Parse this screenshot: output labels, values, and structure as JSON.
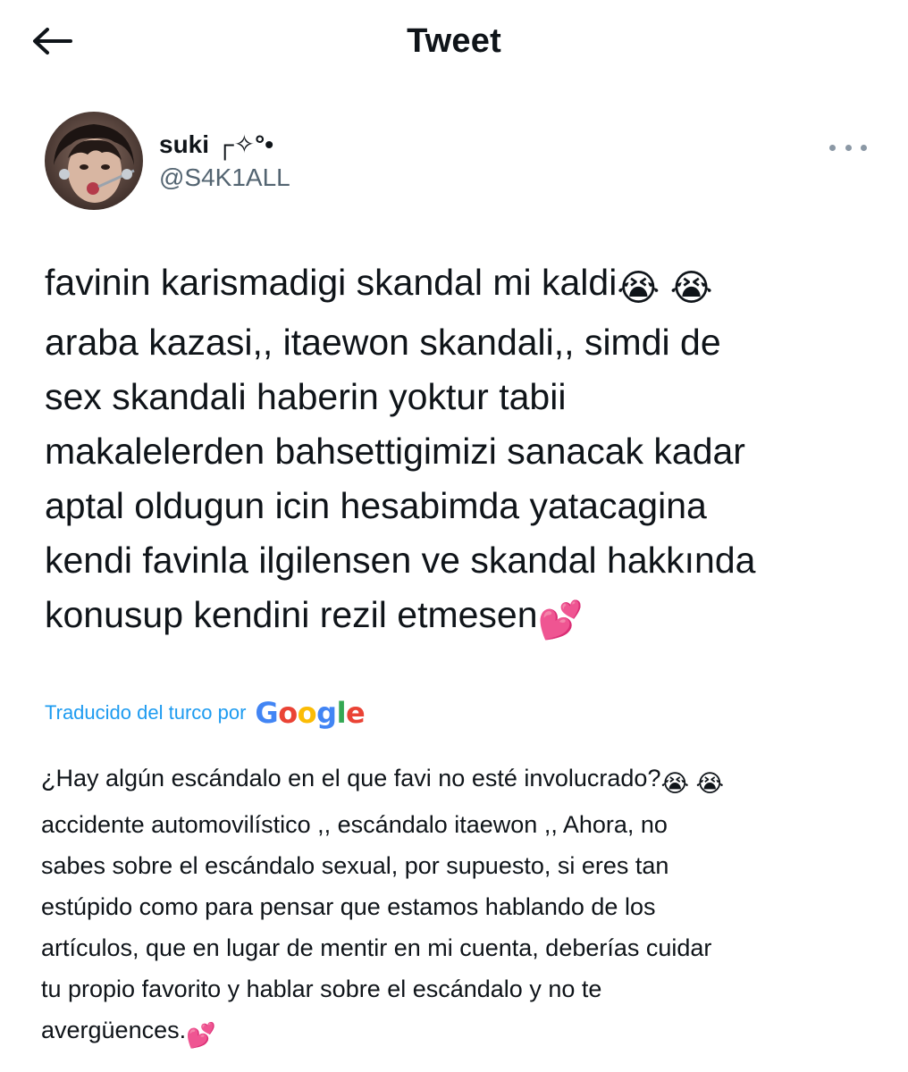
{
  "header": {
    "title": "Tweet",
    "back_icon": "arrow-left-icon"
  },
  "author": {
    "display_name": "suki ┌✧°•",
    "handle": "@S4K1ALL",
    "avatar_icon": "user-avatar",
    "more_icon": "more-horizontal-icon"
  },
  "tweet": {
    "line1": "favinin karismadigi skandal mi kaldi",
    "rest": "araba kazasi,, itaewon skandali,, simdi de\nsex skandali haberin yoktur tabii\nmakalelerden bahsettigimizi sanacak kadar\naptal oldugun icin hesabimda yatacagina\nkendi favinla ilgilensen ve skandal hakkında\nkonusup kendini rezil etmesen",
    "emoji_crying": "😭",
    "emoji_hearts": "💕"
  },
  "translation": {
    "label": "Traducido del turco por",
    "provider": "Google",
    "line1": "¿Hay algún escándalo en el que favi no esté involucrado?",
    "rest": "accidente automovilístico ,, escándalo itaewon ,, Ahora, no\nsabes sobre el escándalo sexual, por supuesto, si eres tan\nestúpido como para pensar que estamos hablando de los\nartículos, que en lugar de mentir en mi cuenta, deberías cuidar\ntu propio favorito y hablar sobre el escándalo y no te\navergüences."
  },
  "colors": {
    "text": "#0f1419",
    "secondary": "#536471",
    "link": "#1d9bf0"
  }
}
